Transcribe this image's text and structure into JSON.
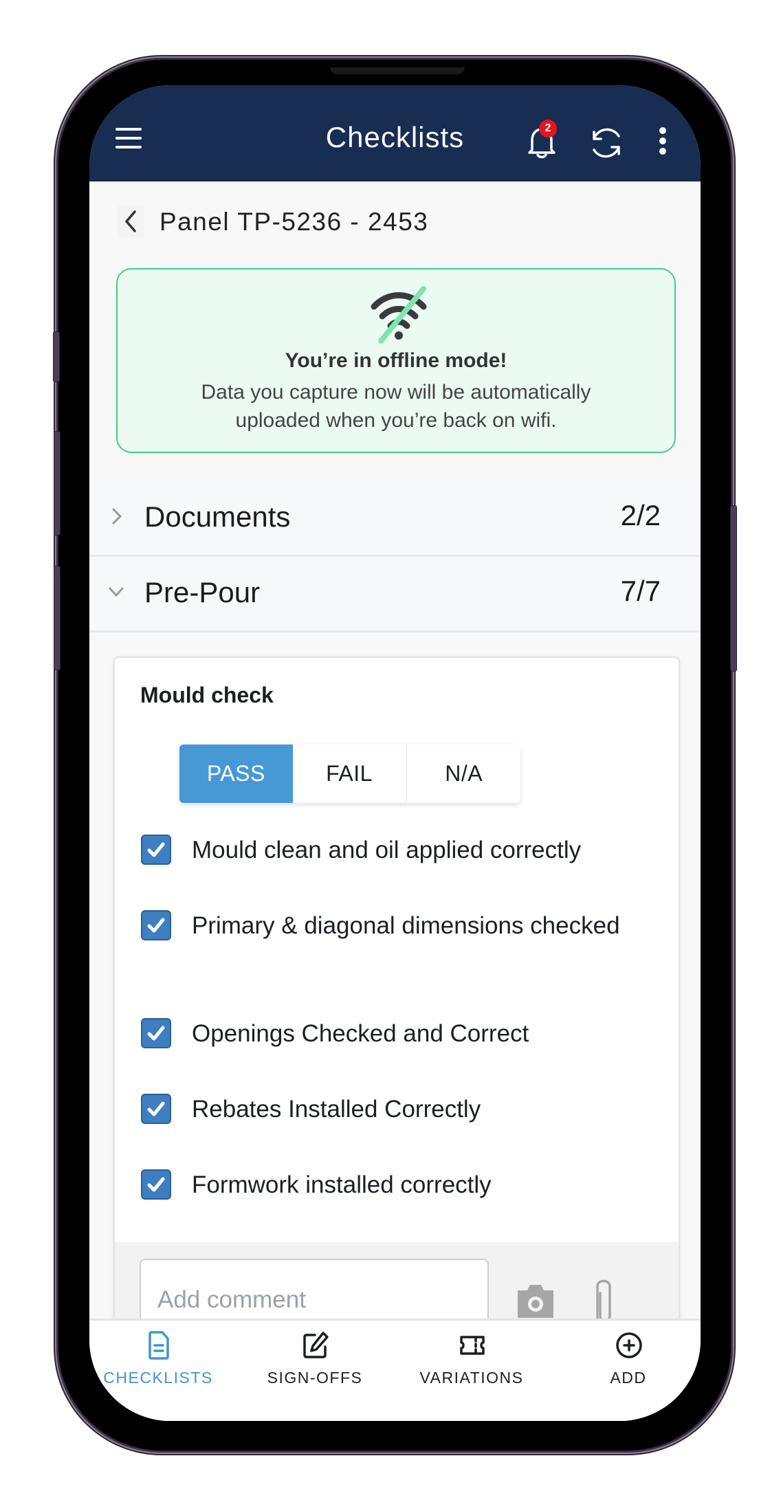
{
  "header": {
    "title": "Checklists",
    "menu_icon": "hamburger-icon",
    "notifications": {
      "icon": "bell-icon",
      "badge_count": "2"
    },
    "sync_icon": "sync-icon",
    "more_icon": "more-vertical-icon"
  },
  "panel": {
    "back_icon": "chevron-left-icon",
    "title": "Panel TP-5236 - 2453"
  },
  "offline_banner": {
    "icon": "wifi-off-icon",
    "title": "You’re in offline mode!",
    "body": "Data you capture now will be automatically uploaded when you’re back on wifi."
  },
  "sections": [
    {
      "label": "Documents",
      "count": "2/2",
      "expanded": false
    },
    {
      "label": "Pre-Pour",
      "count": "7/7",
      "expanded": true
    }
  ],
  "check_card": {
    "title": "Mould check",
    "result_options": [
      "PASS",
      "FAIL",
      "N/A"
    ],
    "selected_result": "PASS",
    "items": [
      {
        "label": "Mould clean and oil applied correctly",
        "checked": true
      },
      {
        "label": "Primary & diagonal dimensions checked",
        "checked": true
      },
      {
        "label": "Openings Checked and Correct",
        "checked": true
      },
      {
        "label": "Rebates Installed Correctly",
        "checked": true
      },
      {
        "label": "Formwork installed correctly",
        "checked": true
      }
    ],
    "comment": {
      "placeholder": "Add comment",
      "value": ""
    },
    "camera_icon": "camera-icon",
    "attach_icon": "paperclip-icon"
  },
  "bottom_nav": [
    {
      "label": "CHECKLISTS",
      "icon": "document-icon",
      "active": true
    },
    {
      "label": "SIGN-OFFS",
      "icon": "edit-icon",
      "active": false
    },
    {
      "label": "VARIATIONS",
      "icon": "ticket-icon",
      "active": false
    },
    {
      "label": "ADD",
      "icon": "plus-circle-icon",
      "active": false
    }
  ],
  "colors": {
    "header_bg": "#172d52",
    "accent": "#4699d4",
    "checkbox": "#3d7fc0",
    "badge": "#e5161d",
    "offline_border": "#3fd17e",
    "offline_bg": "#ebfbf1"
  }
}
